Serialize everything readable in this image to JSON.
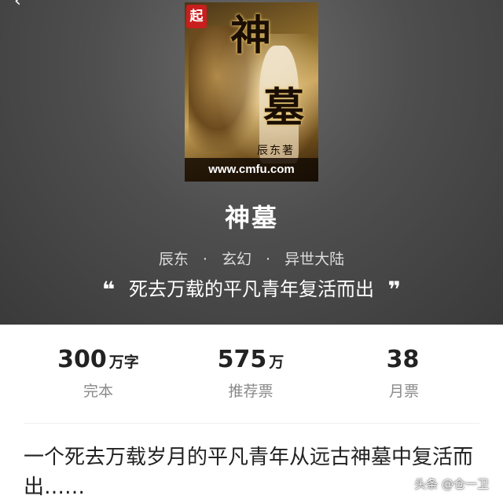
{
  "header": {
    "back_glyph": "‹"
  },
  "cover": {
    "badge": "起",
    "title_char_1": "神",
    "title_char_2": "墓",
    "author_art": "辰东著",
    "url": "www.cmfu.com"
  },
  "book": {
    "title": "神墓",
    "author": "辰东",
    "genre": "玄幻",
    "subgenre": "异世大陆",
    "separator": "·",
    "tagline": "死去万载的平凡青年复活而出",
    "quote_open": "❝",
    "quote_close": "❞"
  },
  "stats": [
    {
      "value": "300",
      "unit": "万字",
      "label": "完本"
    },
    {
      "value": "575",
      "unit": "万",
      "label": "推荐票"
    },
    {
      "value": "38",
      "unit": "",
      "label": "月票"
    }
  ],
  "description": "一个死去万载岁月的平凡青年从远古神墓中复活而出……",
  "watermark": "头条 @仓一卫"
}
